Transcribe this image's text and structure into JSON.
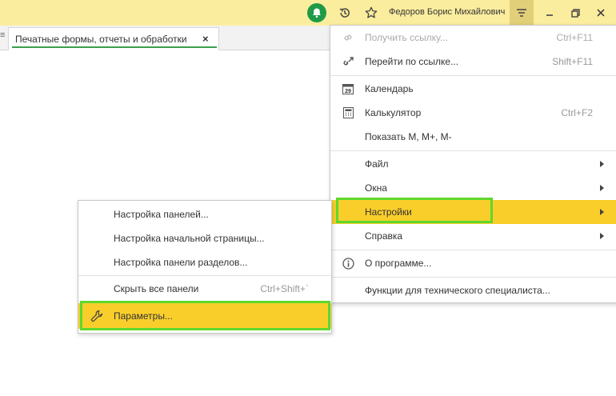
{
  "topbar": {
    "user_name": "Федоров Борис Михайлович",
    "icons": [
      "bell-icon",
      "history-icon",
      "star-icon",
      "main-menu-icon",
      "minimize-icon",
      "restore-icon",
      "close-icon"
    ]
  },
  "tab": {
    "label": "Печатные формы, отчеты и обработки",
    "close": "×",
    "left_edge": "≡"
  },
  "main_menu": {
    "items": [
      {
        "label": "Получить ссылку...",
        "shortcut": "Ctrl+F11",
        "disabled": true
      },
      {
        "label": "Перейти по ссылке...",
        "shortcut": "Shift+F11"
      },
      {
        "label": "Календарь",
        "shortcut": "",
        "icon_text": "29"
      },
      {
        "label": "Калькулятор",
        "shortcut": "Ctrl+F2"
      },
      {
        "label": "Показать М, М+, М-",
        "shortcut": ""
      },
      {
        "label": "Файл",
        "submenu": true
      },
      {
        "label": "Окна",
        "submenu": true
      },
      {
        "label": "Настройки",
        "submenu": true,
        "highlighted": true
      },
      {
        "label": "Справка",
        "submenu": true
      },
      {
        "label": "О программе..."
      },
      {
        "label": "Функции для технического специалиста..."
      }
    ]
  },
  "settings_submenu": {
    "items": [
      {
        "label": "Настройка панелей..."
      },
      {
        "label": "Настройка начальной страницы..."
      },
      {
        "label": "Настройка панели разделов..."
      },
      {
        "label": "Скрыть все панели",
        "shortcut": "Ctrl+Shift+`"
      },
      {
        "label": "Параметры...",
        "highlighted": true
      }
    ]
  },
  "colors": {
    "topbar": "#fbed9e",
    "highlight": "#f9ce2b",
    "highlight_frame": "#5fd72c",
    "bell": "#1f9a48",
    "tab_underline": "#3aa04d"
  }
}
